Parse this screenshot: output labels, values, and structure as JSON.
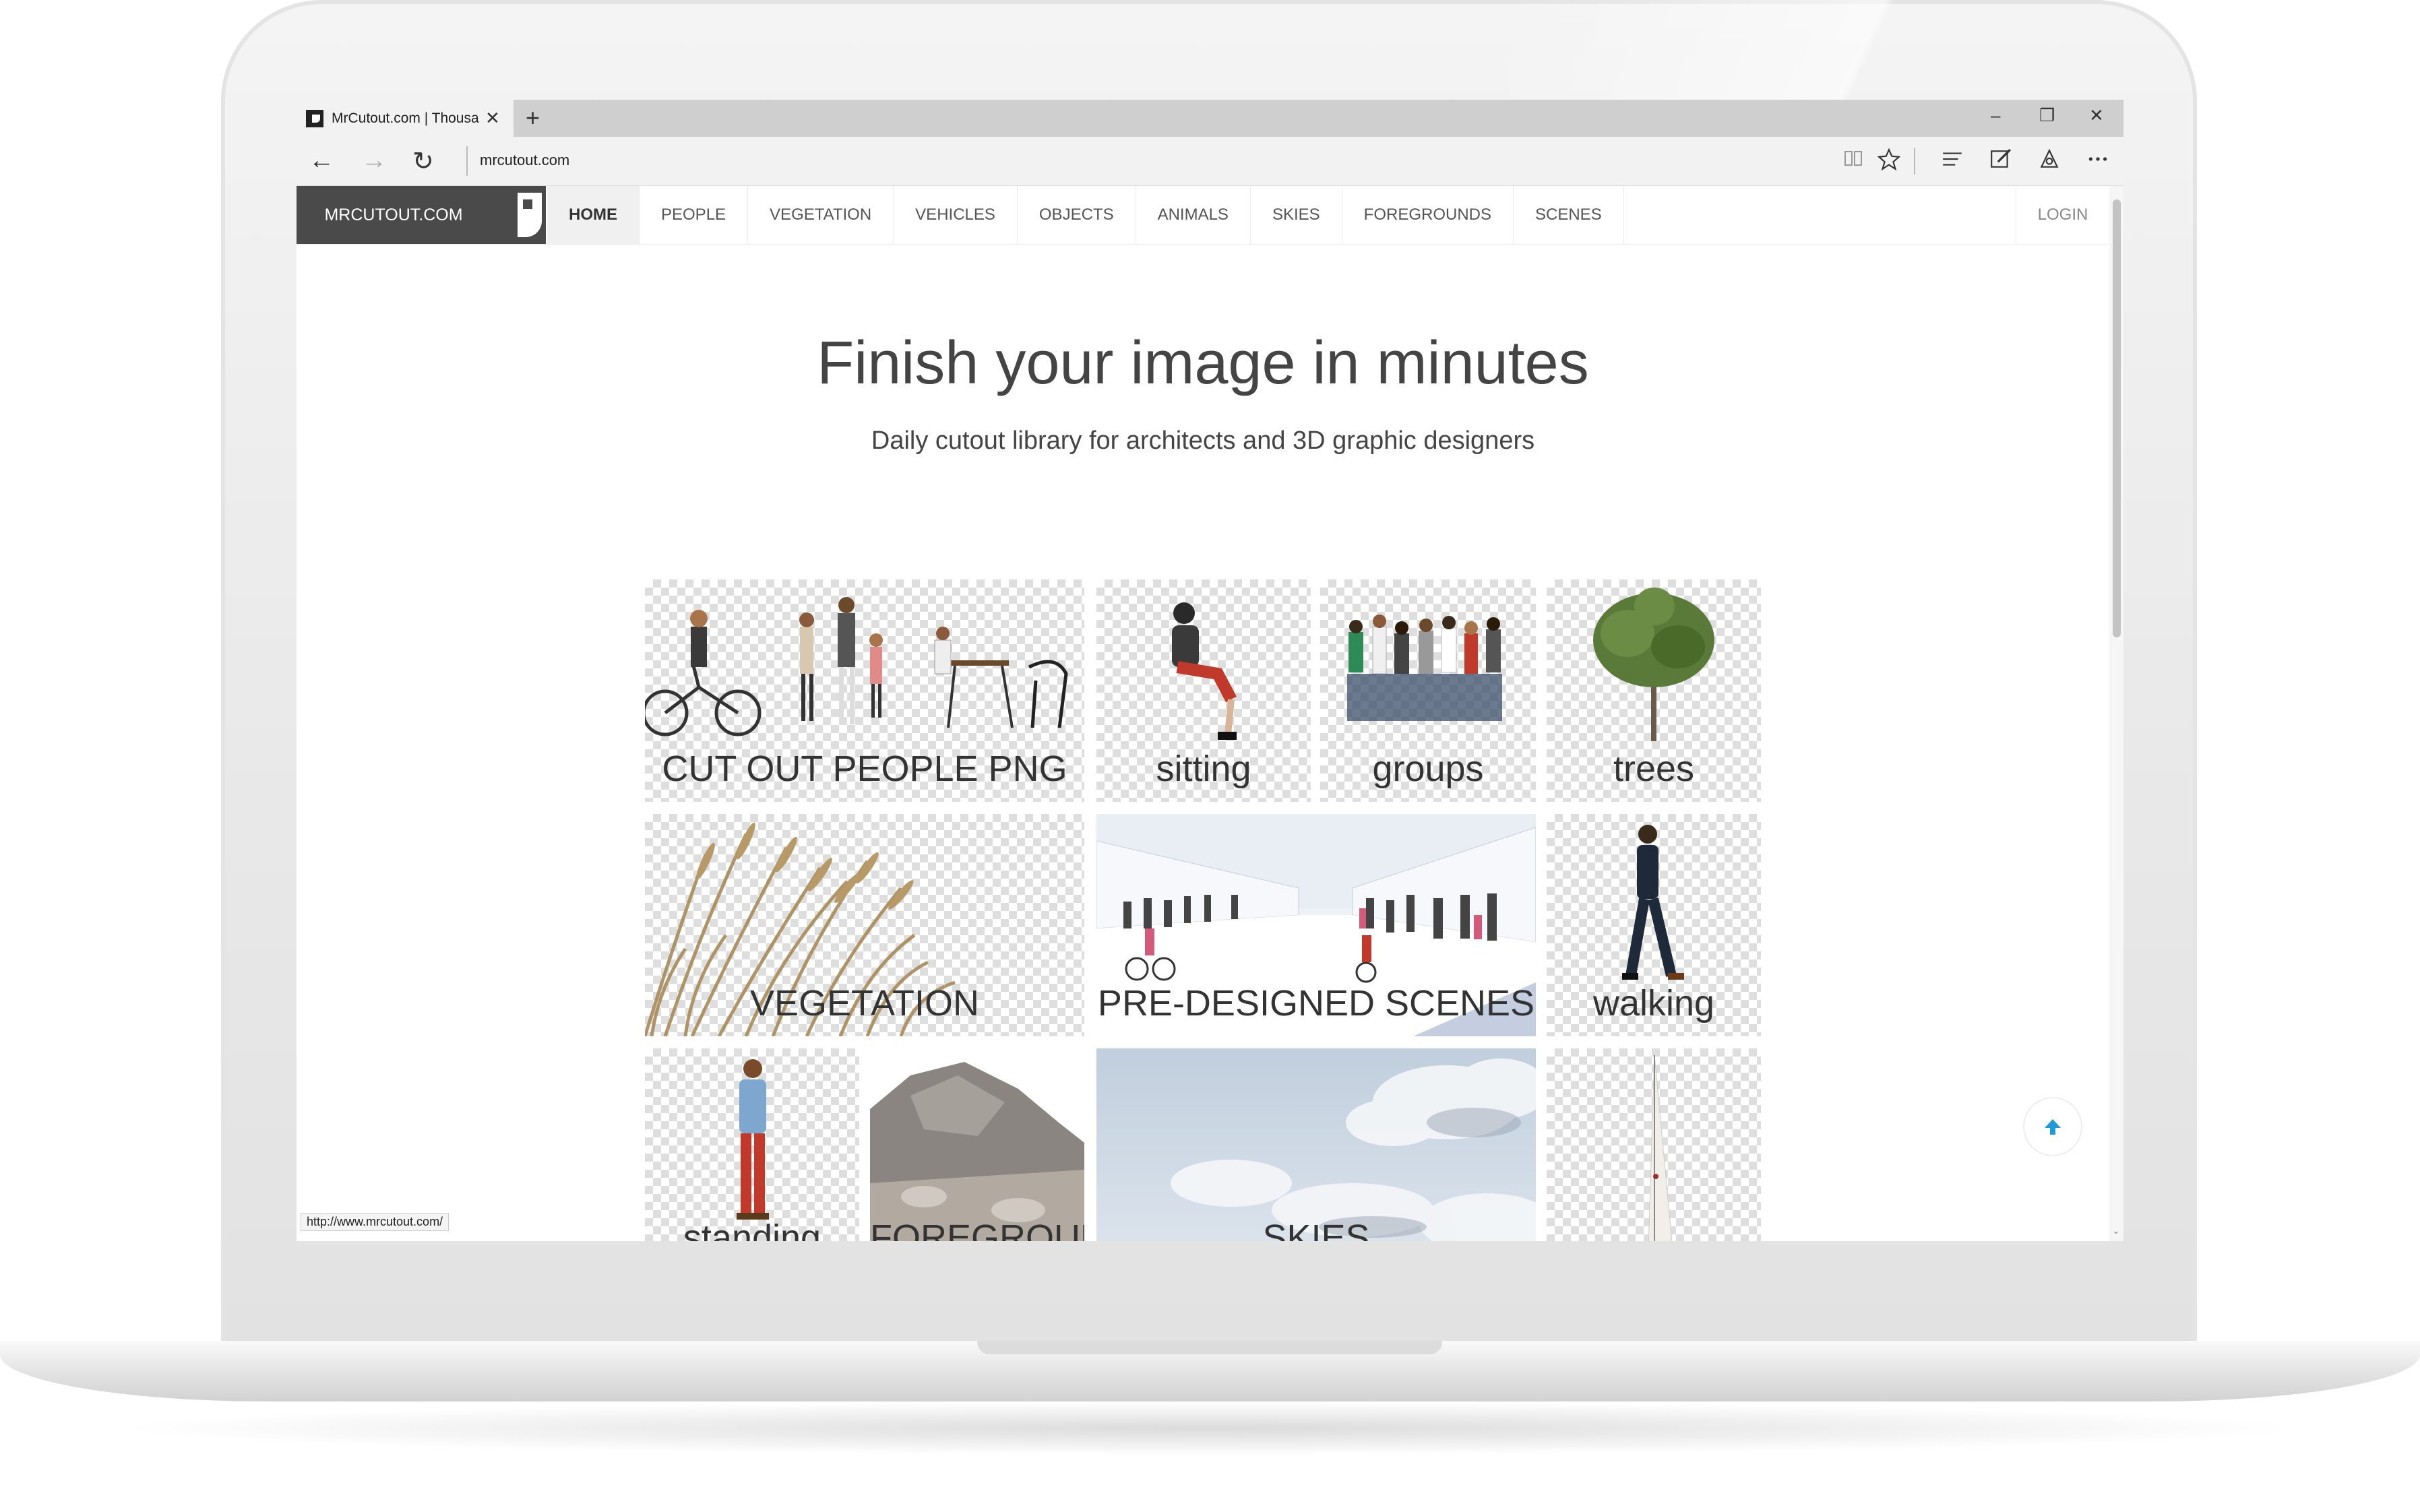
{
  "browser": {
    "tab_title": "MrCutout.com | Thousa",
    "tab_close": "✕",
    "new_tab": "+",
    "url": "mrcutout.com",
    "status_url": "http://www.mrcutout.com/",
    "window_minimize": "–",
    "window_restore": "❐",
    "window_close": "✕",
    "back": "←",
    "forward": "→",
    "refresh": "↻",
    "icons": [
      "reading-view-icon",
      "favorite-star-icon",
      "hub-icon",
      "web-note-icon",
      "share-icon",
      "more-icon"
    ]
  },
  "site": {
    "brand": "MRCUTOUT.COM",
    "nav": [
      "HOME",
      "PEOPLE",
      "VEGETATION",
      "VEHICLES",
      "OBJECTS",
      "ANIMALS",
      "SKIES",
      "FOREGROUNDS",
      "SCENES"
    ],
    "active_nav": "HOME",
    "login": "LOGIN",
    "hero_title": "Finish your image in minutes",
    "hero_subtitle": "Daily cutout library for architects and 3D graphic designers"
  },
  "grid": {
    "cards": {
      "people": "CUT OUT PEOPLE PNG",
      "sitting": "sitting",
      "groups": "groups",
      "trees": "trees",
      "vegetation": "VEGETATION",
      "scenes": "PRE-DESIGNED SCENES",
      "walking": "walking",
      "standing": "standing",
      "foreground": "FOREGROUND",
      "skies": "SKIES",
      "boat": ""
    }
  },
  "colors": {
    "accent": "#1e9bd7",
    "brand_bg": "#4a4a4a",
    "text": "#444444"
  }
}
